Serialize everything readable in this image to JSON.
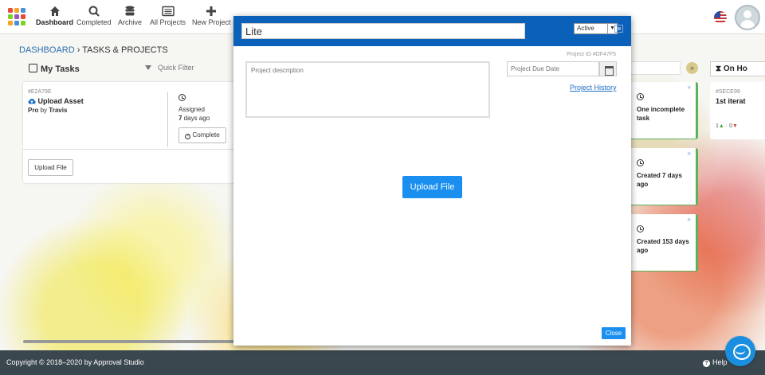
{
  "nav": {
    "items": [
      {
        "label": "Dashboard",
        "icon": "home-icon"
      },
      {
        "label": "Completed",
        "icon": "search-icon"
      },
      {
        "label": "Archive",
        "icon": "database-icon"
      },
      {
        "label": "All Projects",
        "icon": "list-icon"
      },
      {
        "label": "New Project",
        "icon": "plus-icon"
      }
    ]
  },
  "breadcrumb": {
    "home": "DASHBOARD",
    "current": "TASKS & PROJECTS"
  },
  "tasks_panel": {
    "title": "My Tasks",
    "filter_placeholder": "Quick Filter"
  },
  "task_card": {
    "id": "#E2A79E",
    "title": "Upload Asset",
    "project": "Pro",
    "by": "by",
    "user": "Travis",
    "status": "Assigned",
    "age_value": "7",
    "age_unit": "days ago",
    "complete_label": "Complete",
    "upload_label": "Upload File"
  },
  "right_column": {
    "on_hold_label": "On Ho",
    "cards": [
      {
        "text": "One incomplete task"
      },
      {
        "text": "Created 7 days ago"
      },
      {
        "text": "Created 153 days ago"
      }
    ],
    "far_card": {
      "id": "#SECE99",
      "title": "1st iterat",
      "up_count": "1",
      "sep": "·",
      "down_count": "0"
    }
  },
  "modal": {
    "title_value": "Lite",
    "status": "Active",
    "project_id": "Project ID #DF47F5",
    "description_placeholder": "Project description",
    "due_date_placeholder": "Project Due Date",
    "history_link": "Project History",
    "upload_label": "Upload File",
    "close_label": "Close"
  },
  "footer": {
    "copyright": "Copyright © 2018–2020 by Approval Studio",
    "help": "Help"
  },
  "colors": {
    "modal_header": "#0b61b9",
    "accent": "#1a8ff0",
    "footer": "#3b474f",
    "card_border": "#5ab35a"
  }
}
